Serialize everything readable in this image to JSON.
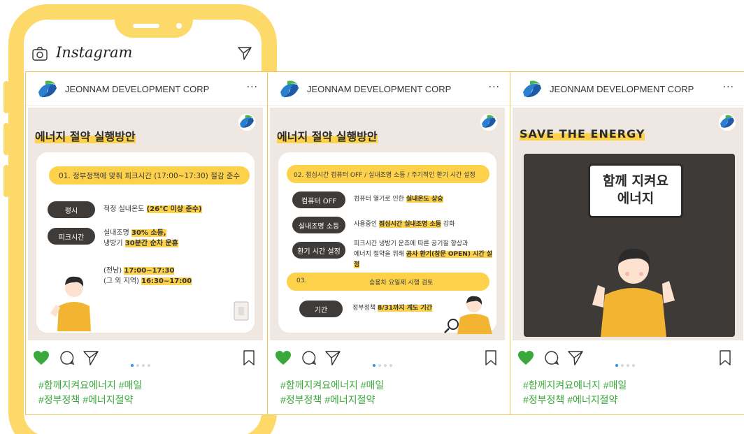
{
  "app": {
    "name": "Instagram"
  },
  "posts": [
    {
      "account": "JEONNAM DEVELOPMENT CORP",
      "more": "···",
      "slide": {
        "title": "에너지 절약 실행방안",
        "pill": "01.   정부정책에 맞춰 피크시간 (17:00~17:30) 절감 준수",
        "rows": [
          {
            "tag": "평시",
            "text_a": "적정 실내온도 ",
            "text_hl": "(26℃ 이상 준수)",
            "text_b": ""
          },
          {
            "tag": "피크시간",
            "text_a": "실내조명 ",
            "text_hl": "30% 소등,",
            "text_b": "",
            "line2_a": "냉방기 ",
            "line2_hl": "30분간 순차 운휴"
          }
        ],
        "times": [
          {
            "label": "(전남) ",
            "value": "17:00~17:30"
          },
          {
            "label": "(그 외 지역) ",
            "value": "16:30~17:00"
          }
        ]
      },
      "hashtags": [
        "#함께지켜요에너지 #매일",
        "#정부정책 #에너지절약"
      ]
    },
    {
      "account": "JEONNAM DEVELOPMENT CORP",
      "more": "···",
      "slide": {
        "title": "에너지 절약 실행방안",
        "pill": "02. 점심시간 컴퓨터 OFF / 실내조명 소등 / 주기적인 환기 시간 설정",
        "rows": [
          {
            "tag": "컴퓨터 OFF",
            "text_a": "컴퓨터 열기로 인한 ",
            "text_hl": "실내온도 상승"
          },
          {
            "tag": "실내조명 소등",
            "text_a": "사용중인 ",
            "text_hl": "점심시간 실내조명 소등",
            "text_b": " 강화"
          },
          {
            "tag": "환기 시간 설정",
            "text_a": "피크시간 냉방기 운휴에 따른 공기질 향상과",
            "line2_a": "에너지 절약을 위해 ",
            "line2_hl": "공사 환기(창문 OPEN) 시간 설정"
          }
        ],
        "pill2_num": "03.",
        "pill2": "승용차 요일제 시행 검토",
        "row4": {
          "tag": "기간",
          "text_a": "정부정책 ",
          "text_hl": "8/31까지 계도 기간"
        }
      },
      "hashtags": [
        "#함께지켜요에너지 #매일",
        "#정부정책 #에너지절약"
      ]
    },
    {
      "account": "JEONNAM DEVELOPMENT CORP",
      "more": "···",
      "slide": {
        "title": "SAVE THE ENERGY",
        "bubble_line1": "함께 지켜요",
        "bubble_line2": "에너지"
      },
      "hashtags": [
        "#함께지켜요에너지 #매일",
        "#정부정책 #에너지절약"
      ]
    }
  ],
  "icons": {
    "heart": "heart-icon",
    "comment": "comment-icon",
    "send": "send-icon",
    "save": "bookmark-icon",
    "camera": "camera-icon",
    "dm": "direct-message-icon"
  },
  "colors": {
    "accent": "#fdd24a",
    "frame": "#fdd96a",
    "hashtag": "#3aa83a",
    "heart": "#3aa83a",
    "dot_active": "#3a8de0"
  }
}
